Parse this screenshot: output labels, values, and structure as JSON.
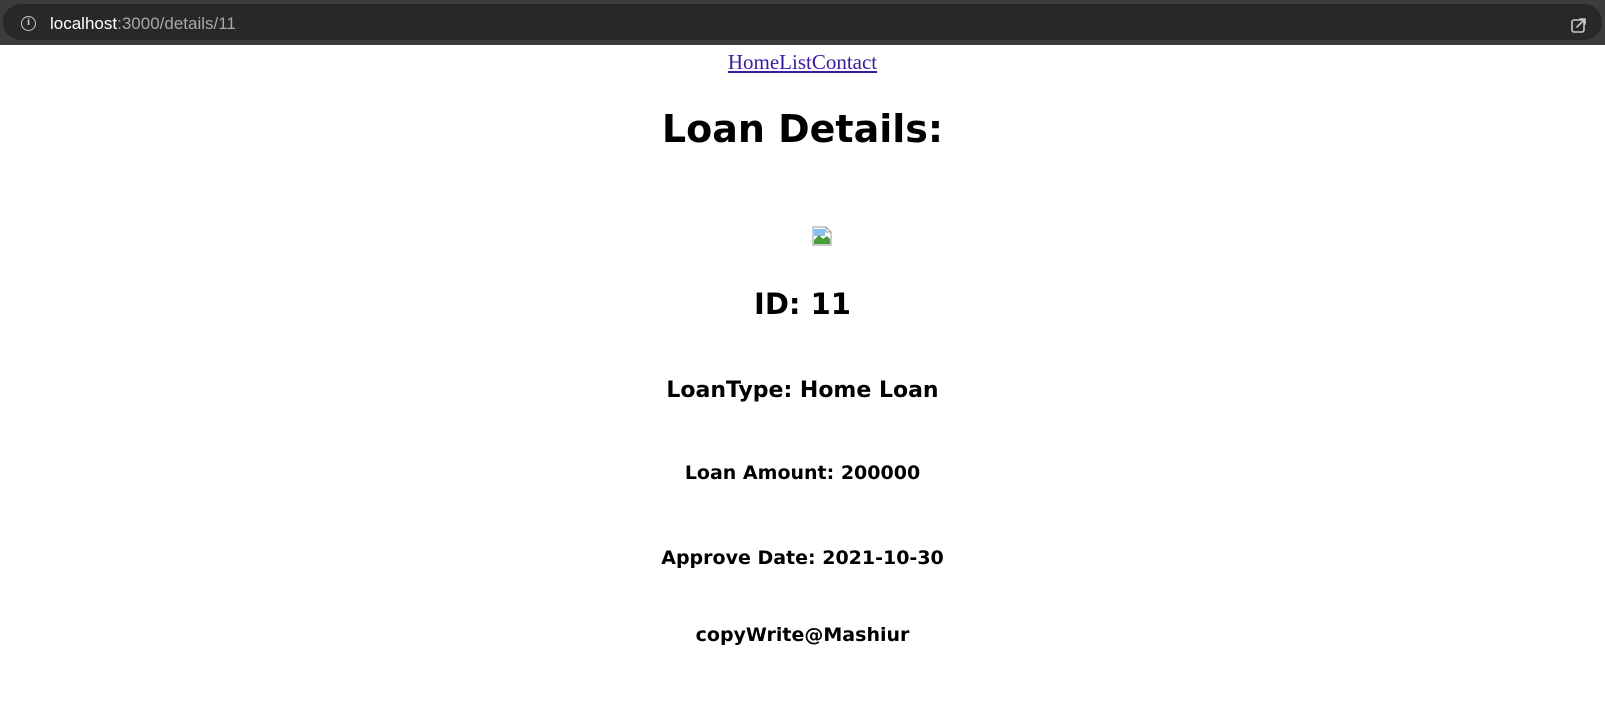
{
  "browser": {
    "url_host": "localhost",
    "url_path": ":3000/details/11",
    "icons": {
      "site_info": "info-icon",
      "share": "share-icon"
    }
  },
  "nav": {
    "links": [
      "Home",
      "List",
      "Contact"
    ],
    "link_color": "#3a1c9e"
  },
  "main": {
    "title": "Loan Details:",
    "image": {
      "icon": "broken-image-icon"
    },
    "id_text": "ID: 11",
    "loan_type_text": "LoanType: Home Loan",
    "amount_text": "Loan Amount: 200000",
    "approve_date_text": "Approve Date: 2021-10-30"
  },
  "footer": {
    "text": "copyWrite@Mashiur"
  }
}
